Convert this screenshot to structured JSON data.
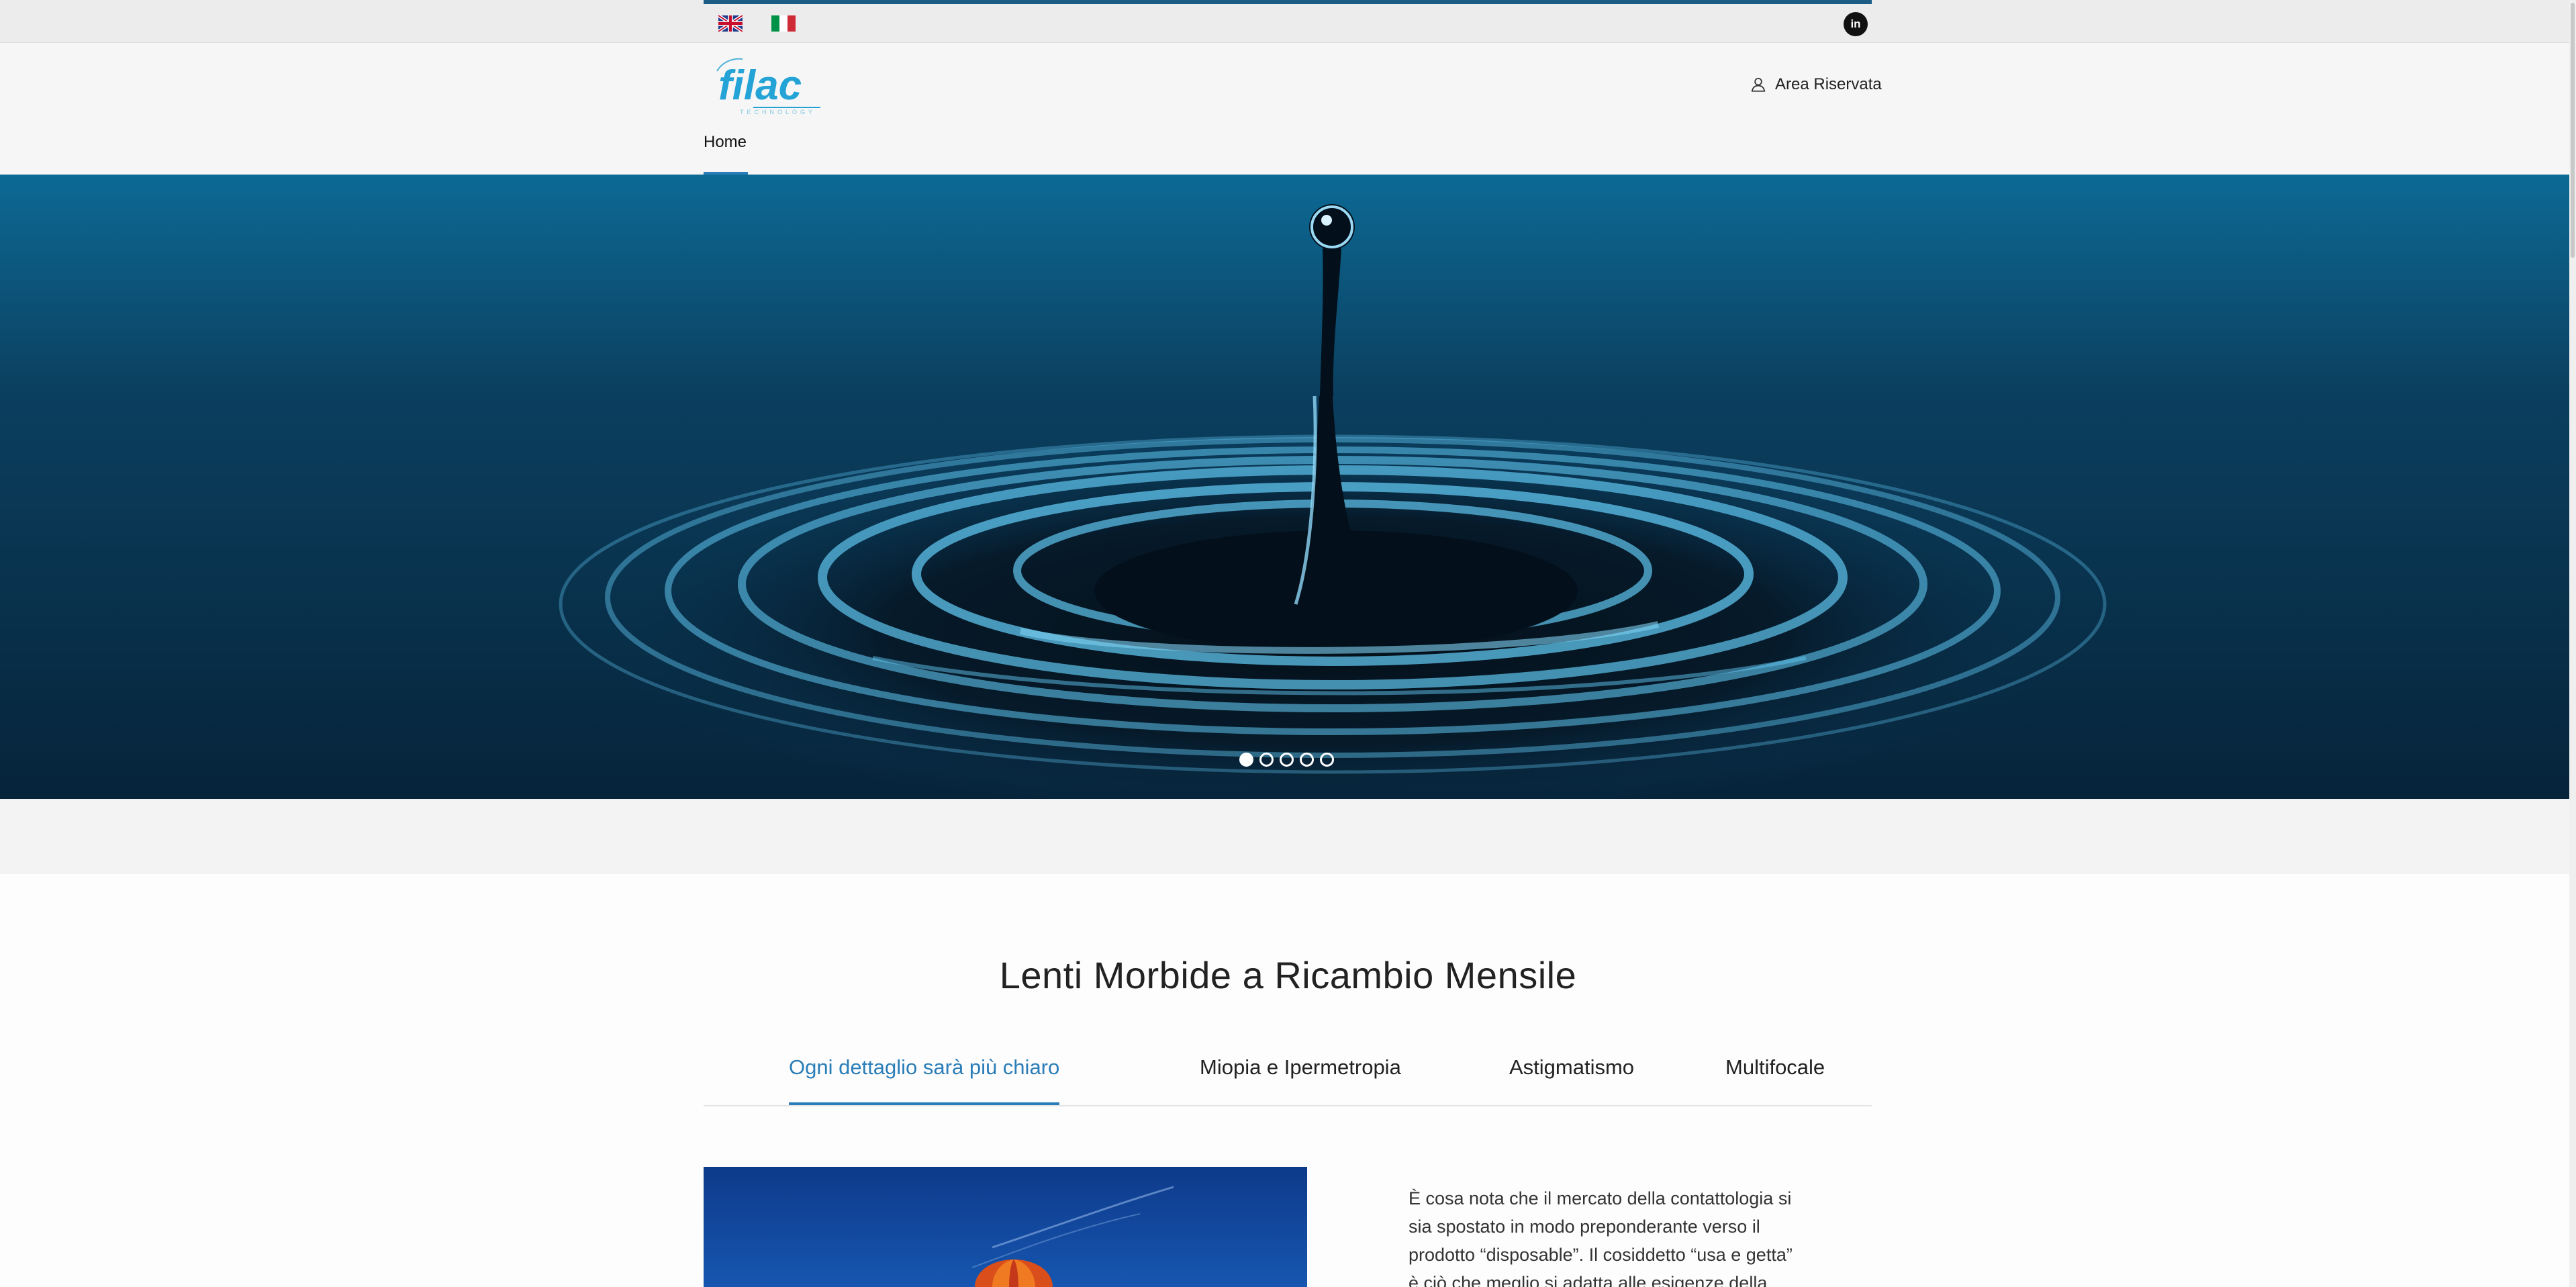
{
  "topbar": {
    "languages": [
      {
        "name": "English",
        "icon": "uk-flag-icon"
      },
      {
        "name": "Italiano",
        "icon": "italy-flag-icon"
      }
    ],
    "social_icon": "linkedin-icon",
    "social_label": "in"
  },
  "header": {
    "logo_text": "filac",
    "logo_subtext": "TECHNOLOGY",
    "area_riservata_label": "Area Riservata",
    "area_riservata_icon": "user-icon"
  },
  "nav": {
    "items": [
      {
        "label": "Home",
        "active": true
      }
    ]
  },
  "hero": {
    "image": "water-drop-splash",
    "slides_total": 5,
    "active_slide": 1
  },
  "section": {
    "title": "Lenti Morbide a Ricambio Mensile",
    "tabs": [
      {
        "label": "Ogni dettaglio sarà più chiaro",
        "active": true
      },
      {
        "label": "Miopia e Ipermetropia",
        "active": false
      },
      {
        "label": "Astigmatismo",
        "active": false
      },
      {
        "label": "Multifocale",
        "active": false
      }
    ],
    "image": "hot-air-balloon",
    "paragraph_lines": [
      "È cosa nota che il mercato della contattologia si",
      "sia spostato in modo preponderante verso il",
      "prodotto “disposable”. Il cosiddetto “usa e getta”",
      "è ciò che meglio si adatta alle esigenze della"
    ]
  },
  "colors": {
    "accent": "#2a7db8",
    "topbar_accent": "#1c5d86",
    "hero_dark": "#0a2f49"
  }
}
